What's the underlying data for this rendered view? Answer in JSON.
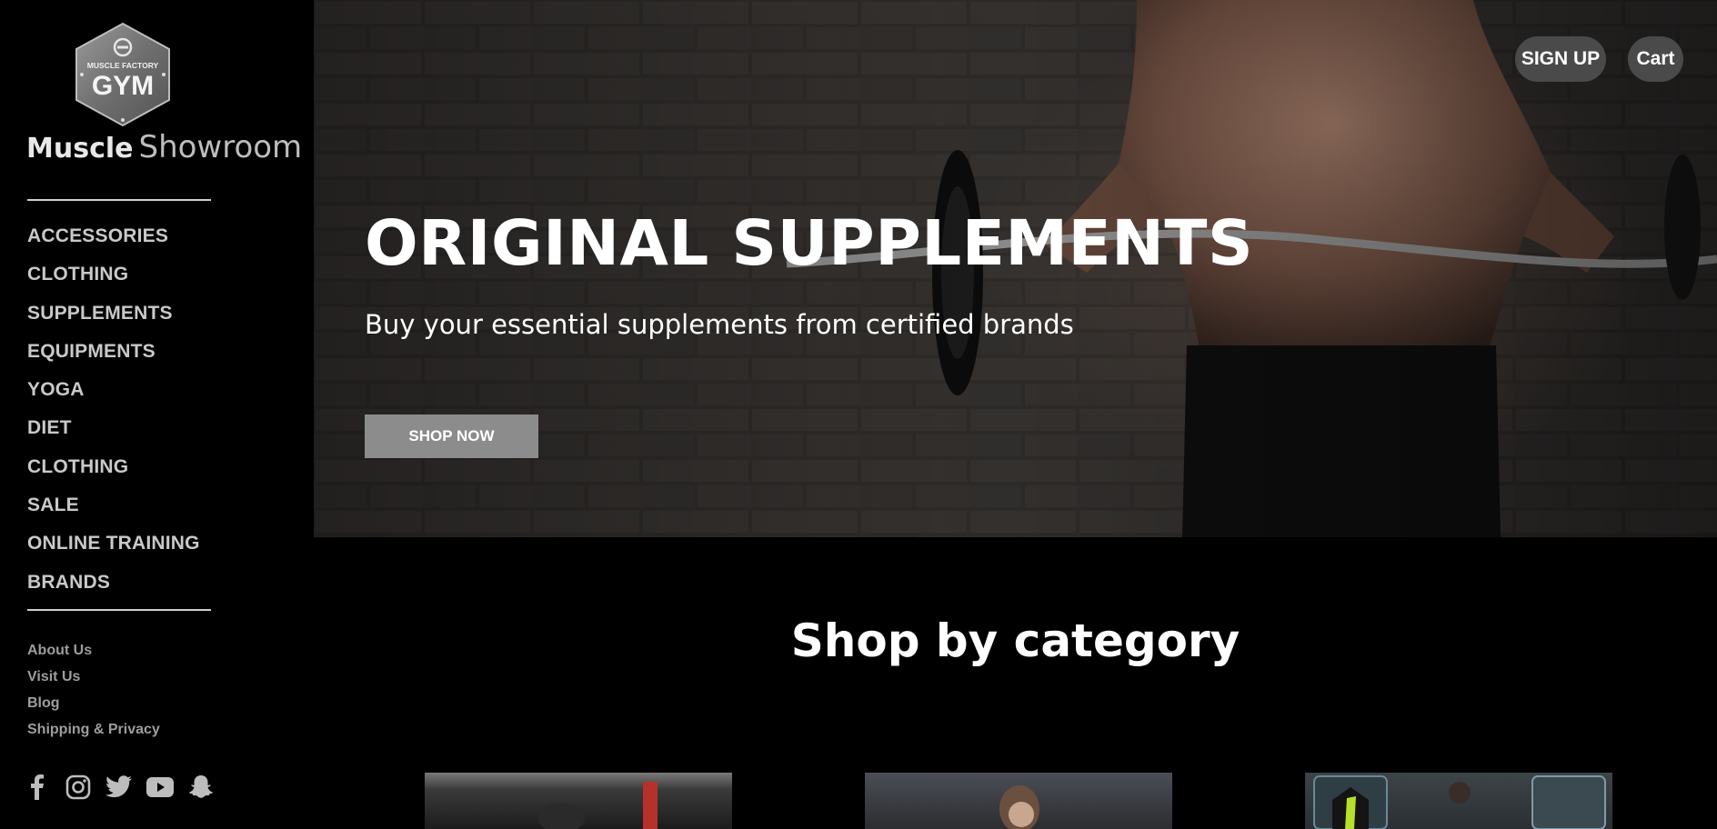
{
  "brand": {
    "logo_text_small": "MUSCLE FACTORY",
    "logo_text_big": "GYM",
    "name_bold": "Muscle",
    "name_light": "Showroom"
  },
  "nav": {
    "items": [
      {
        "label": "ACCESSORIES"
      },
      {
        "label": "CLOTHING"
      },
      {
        "label": "SUPPLEMENTS"
      },
      {
        "label": "EQUIPMENTS"
      },
      {
        "label": "YOGA"
      },
      {
        "label": "DIET"
      },
      {
        "label": "CLOTHING"
      },
      {
        "label": "SALE"
      },
      {
        "label": "ONLINE TRAINING"
      },
      {
        "label": "BRANDS"
      }
    ]
  },
  "footer_links": [
    {
      "label": "About Us"
    },
    {
      "label": "Visit Us"
    },
    {
      "label": "Blog"
    },
    {
      "label": "Shipping & Privacy"
    }
  ],
  "social": [
    "facebook-icon",
    "instagram-icon",
    "twitter-icon",
    "youtube-icon",
    "snapchat-icon"
  ],
  "header": {
    "signup_label": "SIGN UP",
    "cart_label": "Cart"
  },
  "hero": {
    "title": "ORIGINAL SUPPLEMENTS",
    "subtitle": "Buy your essential supplements from certified brands",
    "cta_label": "SHOP NOW"
  },
  "categories": {
    "title": "Shop by category"
  },
  "colors": {
    "background": "#000000",
    "button_gray": "#8c8c8c",
    "pill_gray": "#4a4a4a",
    "nav_text": "#c9c9c9"
  }
}
